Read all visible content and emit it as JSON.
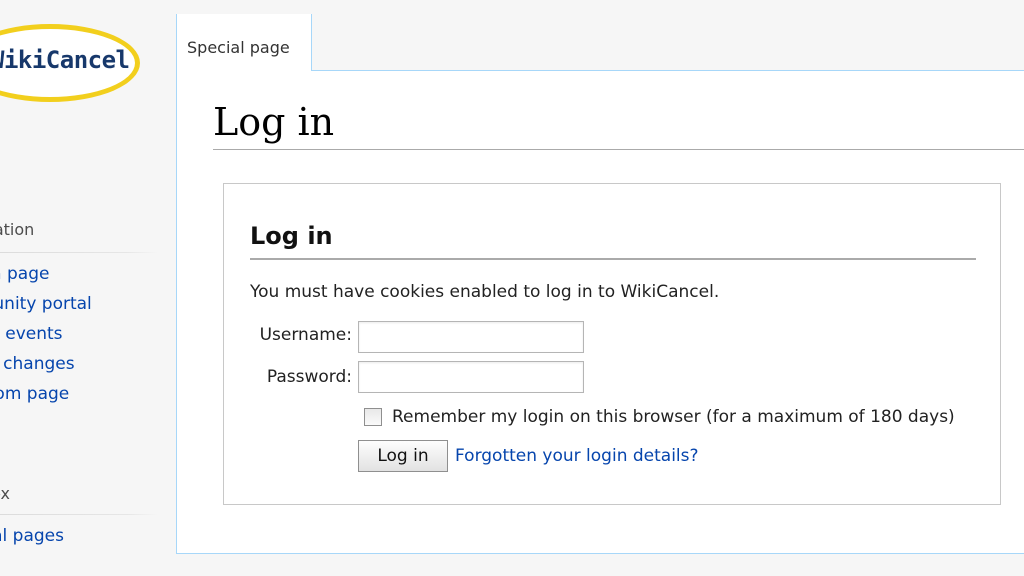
{
  "logo": {
    "text": "WikiCancel"
  },
  "sidebar": {
    "navigation": {
      "heading": "Navigation",
      "items": [
        {
          "label": "Main page"
        },
        {
          "label": "Community portal"
        },
        {
          "label": "Current events"
        },
        {
          "label": "Recent changes"
        },
        {
          "label": "Random page"
        }
      ]
    },
    "toolbox": {
      "heading": "Toolbox",
      "items": [
        {
          "label": "Special pages"
        }
      ]
    }
  },
  "tabs": [
    {
      "label": "Special page"
    }
  ],
  "main": {
    "title": "Log in",
    "login_form": {
      "heading": "Log in",
      "notice": "You must have cookies enabled to log in to WikiCancel.",
      "username_label": "Username:",
      "username_value": "",
      "password_label": "Password:",
      "password_value": "",
      "remember_label": "Remember my login on this browser (for a maximum of 180 days)",
      "remember_checked": false,
      "submit_label": "Log in",
      "forgot_link": "Forgotten your login details?"
    }
  },
  "colors": {
    "link": "#0645ad",
    "logo_ring": "#f2cf1d",
    "logo_text": "#17386b",
    "tab_border": "#a7d7f9"
  }
}
